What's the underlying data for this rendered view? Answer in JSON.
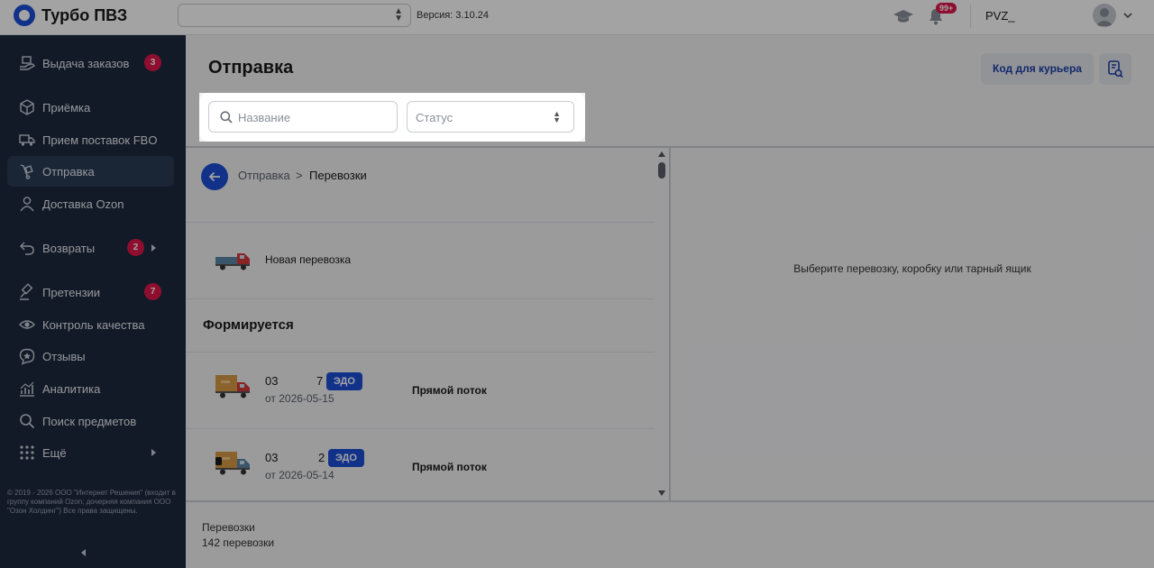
{
  "app": {
    "title": "Турбо ПВЗ",
    "version": "Версия: 3.10.24"
  },
  "header": {
    "notifications_badge": "99+",
    "user_name": "PVZ_",
    "location_select_value": ""
  },
  "sidebar": {
    "items": [
      {
        "label": "Выдача заказов",
        "badge": "3",
        "icon": "handover-icon",
        "active": false
      },
      {
        "label": "Приёмка",
        "icon": "box-icon",
        "active": false
      },
      {
        "label": "Прием поставок FBO",
        "icon": "truck-fbo-icon",
        "active": false
      },
      {
        "label": "Отправка",
        "icon": "dolly-icon",
        "active": true
      },
      {
        "label": "Доставка Ozon",
        "icon": "person-icon",
        "active": false
      },
      {
        "label": "Возвраты",
        "badge": "2",
        "icon": "return-icon",
        "active": false,
        "has_submenu": true
      },
      {
        "label": "Претензии",
        "badge": "7",
        "icon": "gavel-icon",
        "active": false
      },
      {
        "label": "Контроль качества",
        "icon": "eye-icon",
        "active": false
      },
      {
        "label": "Отзывы",
        "icon": "star-chat-icon",
        "active": false
      },
      {
        "label": "Аналитика",
        "icon": "chart-icon",
        "active": false
      },
      {
        "label": "Поиск предметов",
        "icon": "search-icon",
        "active": false
      },
      {
        "label": "Ещё",
        "icon": "grid-icon",
        "active": false,
        "has_submenu": true
      }
    ],
    "copyright": "© 2019 - 2026 ООО \"Интернет Решения\" (входит в группу компаний Ozon; дочерняя компания ООО \"Озон Холдинг\") Все права защищены."
  },
  "main": {
    "title": "Отправка",
    "courier_button": "Код для курьера",
    "filters": {
      "search_placeholder": "Название",
      "status_label": "Статус"
    },
    "breadcrumb": {
      "parent": "Отправка",
      "separator": ">",
      "current": "Перевозки"
    },
    "new_shipment_label": "Новая перевозка",
    "section_title": "Формируется",
    "rows": [
      {
        "id_start": "03",
        "id_end": "7",
        "badge": "ЭДО",
        "date": "от 2026-05-15",
        "flow": "Прямой поток"
      },
      {
        "id_start": "03",
        "id_end": "2",
        "badge": "ЭДО",
        "date": "от 2026-05-14",
        "flow": "Прямой поток"
      }
    ],
    "empty_hint": "Выберите перевозку, коробку или тарный ящик",
    "footer": {
      "title": "Перевозки",
      "count": "142 перевозки"
    }
  },
  "colors": {
    "accent": "#1d4fd8",
    "sidebar_bg": "#1e2a3e",
    "badge": "#e0174b"
  }
}
